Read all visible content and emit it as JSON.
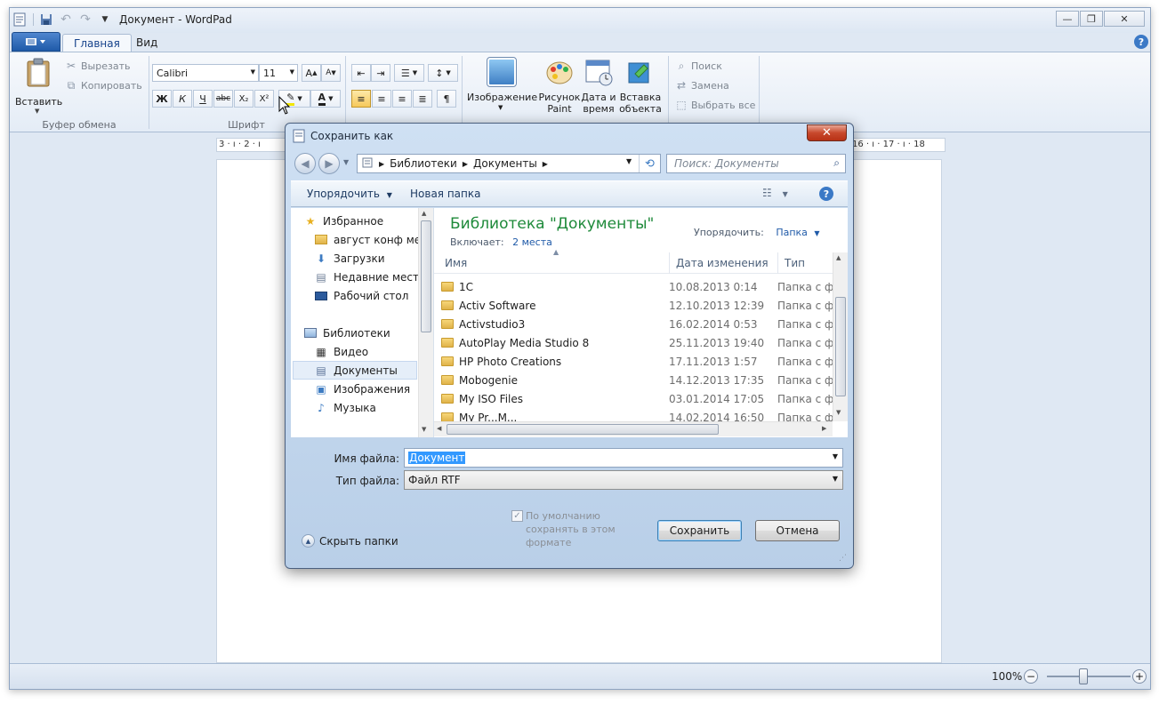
{
  "window": {
    "title": "Документ - WordPad",
    "caption_buttons": [
      "minimize-icon",
      "restore-icon",
      "close-icon"
    ]
  },
  "ribbon": {
    "tabs": [
      {
        "label": "Главная",
        "active": true
      },
      {
        "label": "Вид",
        "active": false
      }
    ],
    "clipboard": {
      "paste_label": "Вставить",
      "cut_label": "Вырезать",
      "copy_label": "Копировать",
      "group_label": "Буфер обмена"
    },
    "font": {
      "font_name": "Calibri",
      "font_size": "11",
      "group_label": "Шрифт",
      "format_buttons": [
        "Ж",
        "К",
        "Ч",
        "abc",
        "X₂",
        "X²"
      ]
    },
    "insert": {
      "image_label": "Изображение",
      "paint_label": "Рисунок Paint",
      "datetime_label": "Дата и время",
      "object_label": "Вставка объекта"
    },
    "editing": {
      "find_label": "Поиск",
      "replace_label": "Замена",
      "select_all_label": "Выбрать все"
    }
  },
  "ruler": {
    "left_marks": "3 · ı · 2 · ı",
    "right_marks": "16 · ı · 17 · ı · 18"
  },
  "statusbar": {
    "zoom": "100%"
  },
  "dialog": {
    "title": "Сохранить как",
    "address": {
      "crumbs": [
        "Библиотеки",
        "Документы"
      ]
    },
    "search_placeholder": "Поиск: Документы",
    "toolbar": {
      "organize_label": "Упорядочить",
      "new_folder_label": "Новая папка"
    },
    "nav": {
      "favorites_label": "Избранное",
      "favorites": [
        "август конф мет",
        "Загрузки",
        "Недавние места",
        "Рабочий стол"
      ],
      "libraries_label": "Библиотеки",
      "libraries": [
        {
          "label": "Видео",
          "icon": "video-library-icon"
        },
        {
          "label": "Документы",
          "icon": "documents-library-icon",
          "selected": true
        },
        {
          "label": "Изображения",
          "icon": "pictures-library-icon"
        },
        {
          "label": "Музыка",
          "icon": "music-library-icon"
        }
      ]
    },
    "library": {
      "heading": "Библиотека \"Документы\"",
      "includes_label": "Включает:",
      "includes_link": "2 места",
      "arrange_label": "Упорядочить:",
      "arrange_value": "Папка"
    },
    "columns": {
      "name": "Имя",
      "date": "Дата изменения",
      "type": "Тип"
    },
    "files": [
      {
        "name": "1C",
        "date": "10.08.2013 0:14",
        "type": "Папка с ф"
      },
      {
        "name": "Activ Software",
        "date": "12.10.2013 12:39",
        "type": "Папка с ф"
      },
      {
        "name": "Activstudio3",
        "date": "16.02.2014 0:53",
        "type": "Папка с ф"
      },
      {
        "name": "AutoPlay Media Studio 8",
        "date": "25.11.2013 19:40",
        "type": "Папка с ф"
      },
      {
        "name": "HP Photo Creations",
        "date": "17.11.2013 1:57",
        "type": "Папка с ф"
      },
      {
        "name": "Mobogenie",
        "date": "14.12.2013 17:35",
        "type": "Папка с ф"
      },
      {
        "name": "My ISO Files",
        "date": "03.01.2014 17:05",
        "type": "Папка с ф"
      },
      {
        "name": "My Pr...M...",
        "date": "14.02.2014 16:50",
        "type": "Папка с ф"
      }
    ],
    "filename_label": "Имя файла:",
    "filename_value": "Документ",
    "filetype_label": "Тип файла:",
    "filetype_value": "Файл RTF",
    "default_checkbox": {
      "label": "По умолчанию сохранять в этом формате",
      "checked": true
    },
    "hide_folders_label": "Скрыть папки",
    "save_label": "Сохранить",
    "cancel_label": "Отмена"
  }
}
